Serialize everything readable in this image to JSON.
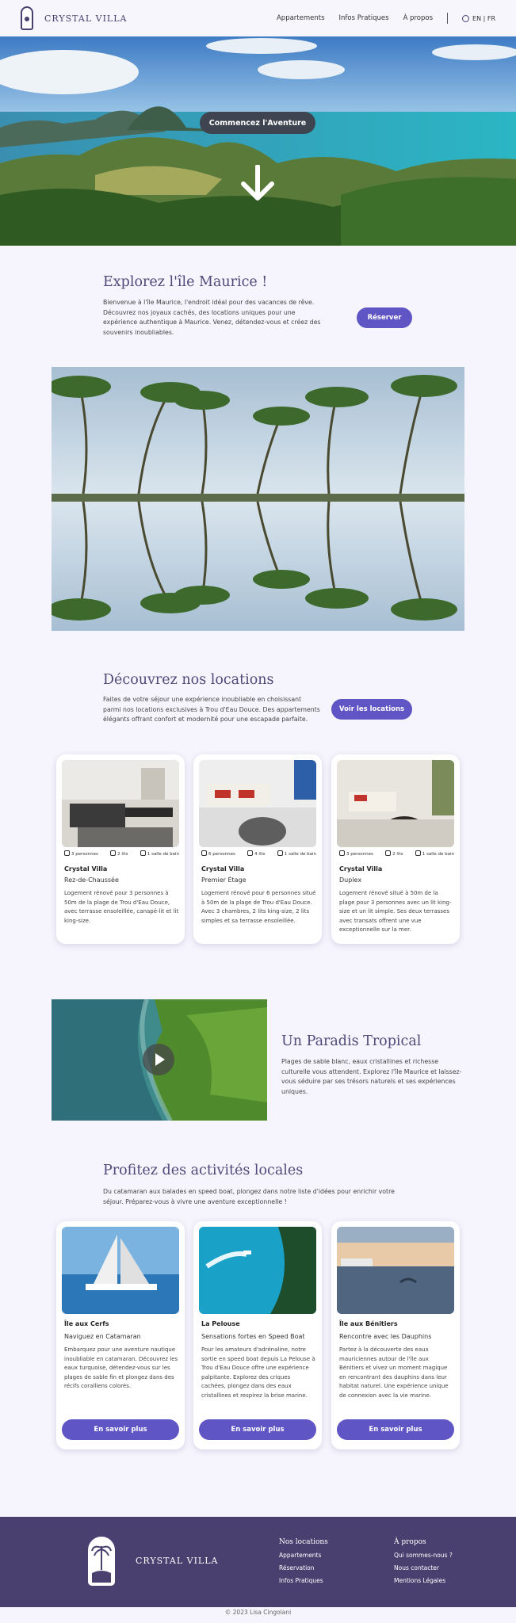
{
  "nav": {
    "brand": "CRYSTAL VILLA",
    "links": [
      "Appartements",
      "Infos Pratiques",
      "À propos"
    ],
    "lang": "EN | FR"
  },
  "hero": {
    "cta": "Commencez l'Aventure"
  },
  "explore": {
    "title": "Explorez l'île Maurice !",
    "text": "Bienvenue à l'île Maurice, l'endroit idéal pour des vacances de rêve. Découvrez nos joyaux cachés, des locations uniques pour une expérience authentique à Maurice. Venez, détendez-vous et créez des souvenirs inoubliables.",
    "button": "Réserver"
  },
  "locations": {
    "title": "Découvrez nos locations",
    "text": "Faites de votre séjour une expérience inoubliable en choisissant parmi nos locations exclusives à Trou d'Eau Douce. Des appartements élégants offrant confort et modernité pour une escapade parfaite.",
    "button": "Voir les locations",
    "cards": [
      {
        "guests": "3 personnes",
        "beds": "2 lits",
        "bath": "1 salle de bain",
        "title": "Crystal Villa",
        "subtitle": "Rez-de-Chaussée",
        "text": "Logement rénové pour 3 personnes à 50m de la plage de Trou d'Eau Douce, avec terrasse ensoleillée, canapé-lit et lit king-size."
      },
      {
        "guests": "6 personnes",
        "beds": "4 lits",
        "bath": "1 salle de bain",
        "title": "Crystal Villa",
        "subtitle": "Premier Étage",
        "text": "Logement rénové pour 6 personnes situé à 50m de la plage de Trou d'Eau Douce. Avec 3 chambres, 2 lits king-size, 2 lits simples et sa terrasse ensoleillée."
      },
      {
        "guests": "3 personnes",
        "beds": "2 lits",
        "bath": "1 salle de bain",
        "title": "Crystal Villa",
        "subtitle": "Duplex",
        "text": "Logement rénové situé à 50m de la plage pour 3 personnes avec un lit king-size et un lit simple. Ses deux terrasses avec transats offrent une vue exceptionnelle sur la mer."
      }
    ]
  },
  "paradise": {
    "title": "Un Paradis Tropical",
    "text": "Plages de sable blanc, eaux cristallines et richesse culturelle vous attendent. Explorez l'île Maurice et laissez-vous séduire par ses trésors naturels et ses expériences uniques."
  },
  "activities": {
    "title": "Profitez des activités locales",
    "text": "Du catamaran aux balades en speed boat, plongez dans notre liste d'idées pour enrichir votre séjour. Préparez-vous à vivre une aventure exceptionnelle !",
    "cards": [
      {
        "title": "Île aux Cerfs",
        "subtitle": "Naviguez en Catamaran",
        "text": "Embarquez pour une aventure nautique inoubliable en catamaran. Découvrez les eaux turquoise, détendez-vous sur les plages de sable fin et plongez dans des récifs coralliens colorés.",
        "button": "En savoir plus"
      },
      {
        "title": "La Pelouse",
        "subtitle": "Sensations fortes en Speed Boat",
        "text": "Pour les amateurs d'adrénaline, notre sortie en speed boat depuis La Pelouse à Trou d'Eau Douce offre une expérience palpitante. Explorez des criques cachées, plongez dans des eaux cristallines et respirez la brise marine.",
        "button": "En savoir plus"
      },
      {
        "title": "Île aux Bénitiers",
        "subtitle": "Rencontre avec les Dauphins",
        "text": "Partez à la découverte des eaux mauriciennes autour de l'île aux Bénitiers et vivez un moment magique en rencontrant des dauphins dans leur habitat naturel. Une expérience unique de connexion avec la vie marine.",
        "button": "En savoir plus"
      }
    ]
  },
  "footer": {
    "brand": "CRYSTAL VILLA",
    "col1": {
      "heading": "Nos locations",
      "links": [
        "Appartements",
        "Réservation",
        "Infos Pratiques"
      ]
    },
    "col2": {
      "heading": "À propos",
      "links": [
        "Qui sommes-nous ?",
        "Nous contacter",
        "Mentions Légales"
      ]
    },
    "copyright": "© 2023 Lisa Cingolani"
  },
  "colors": {
    "accent": "#5f55c4",
    "brand": "#4a4070",
    "heading": "#4f4a7a",
    "background": "#f6f4fc"
  }
}
